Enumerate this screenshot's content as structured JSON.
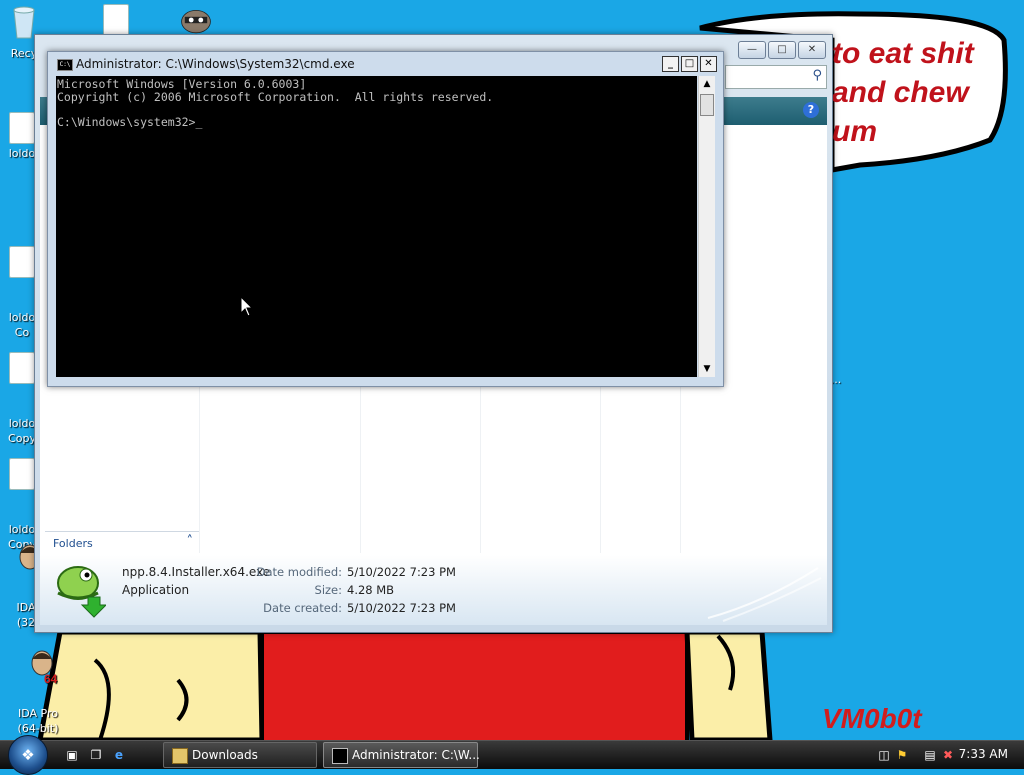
{
  "wallpaper": {
    "speech_lines": [
      "to eat shit",
      "and chew",
      "um"
    ],
    "signature": "VM0b0t",
    "colors": {
      "sky": "#1aa7e6",
      "shirt": "#e11d1d",
      "skin": "#fbeea8"
    }
  },
  "desktop_icons": [
    {
      "name": "recycle-bin",
      "label": "Recy",
      "icon": "recycle-bin-icon"
    },
    {
      "name": "loldo-1",
      "label": "loldo",
      "icon": "document-icon"
    },
    {
      "name": "loldo-2",
      "label": "loldo\nCo",
      "icon": "document-icon"
    },
    {
      "name": "loldo-3",
      "label": "loldo\nCopy",
      "icon": "document-icon"
    },
    {
      "name": "loldo-4",
      "label": "loldo\nCopy",
      "icon": "document-icon"
    },
    {
      "name": "ida-32",
      "label": "IDA\n(32",
      "icon": "ida-icon"
    },
    {
      "name": "ida-64",
      "label": "IDA Pro\n(64-bit)",
      "icon": "ida-icon"
    },
    {
      "name": "right-item",
      "label": "...",
      "icon": "document-icon"
    }
  ],
  "explorer": {
    "title": "Downloads",
    "search_icon": "search-icon",
    "help_label": "?",
    "folders_label": "Folders",
    "details": {
      "file_name": "npp.8.4.Installer.x64.exe",
      "file_type": "Application",
      "props": [
        {
          "key": "Date modified:",
          "value": "5/10/2022 7:23 PM"
        },
        {
          "key": "Size:",
          "value": "4.28 MB"
        },
        {
          "key": "Date created:",
          "value": "5/10/2022 7:23 PM"
        }
      ]
    }
  },
  "cmd": {
    "title": "Administrator: C:\\Windows\\System32\\cmd.exe",
    "console_lines": [
      "Microsoft Windows [Version 6.0.6003]",
      "Copyright (c) 2006 Microsoft Corporation.  All rights reserved.",
      "",
      "C:\\Windows\\system32>_"
    ]
  },
  "taskbar": {
    "start_label": "Start",
    "tasks": [
      {
        "label": "Downloads",
        "icon": "folder-icon"
      },
      {
        "label": "Administrator: C:\\W...",
        "icon": "cmd-icon"
      }
    ],
    "clock": "7:33 AM"
  }
}
